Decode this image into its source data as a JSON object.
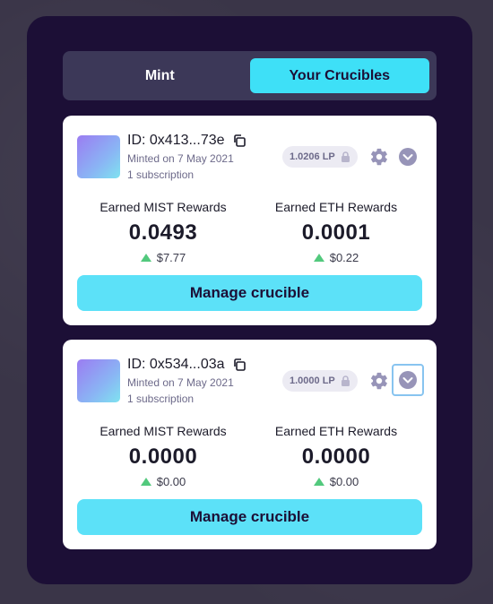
{
  "tabs": [
    {
      "label": "Mint",
      "active": false
    },
    {
      "label": "Your Crucibles",
      "active": true
    }
  ],
  "colors": {
    "accent": "#3ee0f7",
    "button": "#5ce1f8",
    "panel": "#1c0f36",
    "positive": "#52c97d"
  },
  "crucibles": [
    {
      "id": "ID: 0x413...73e",
      "minted": "Minted on 7 May 2021",
      "subscriptions": "1 subscription",
      "lp": "1.0206 LP",
      "rewards": [
        {
          "label": "Earned MIST Rewards",
          "value": "0.0493",
          "usd": "$7.77"
        },
        {
          "label": "Earned ETH Rewards",
          "value": "0.0001",
          "usd": "$0.22"
        }
      ],
      "manage_label": "Manage crucible"
    },
    {
      "id": "ID: 0x534...03a",
      "minted": "Minted on 7 May 2021",
      "subscriptions": "1 subscription",
      "lp": "1.0000 LP",
      "rewards": [
        {
          "label": "Earned MIST Rewards",
          "value": "0.0000",
          "usd": "$0.00"
        },
        {
          "label": "Earned ETH Rewards",
          "value": "0.0000",
          "usd": "$0.00"
        }
      ],
      "manage_label": "Manage crucible"
    }
  ],
  "icons": [
    "copy-icon",
    "lock-icon",
    "gear-icon",
    "chevron-down-icon",
    "arrow-up-icon"
  ]
}
